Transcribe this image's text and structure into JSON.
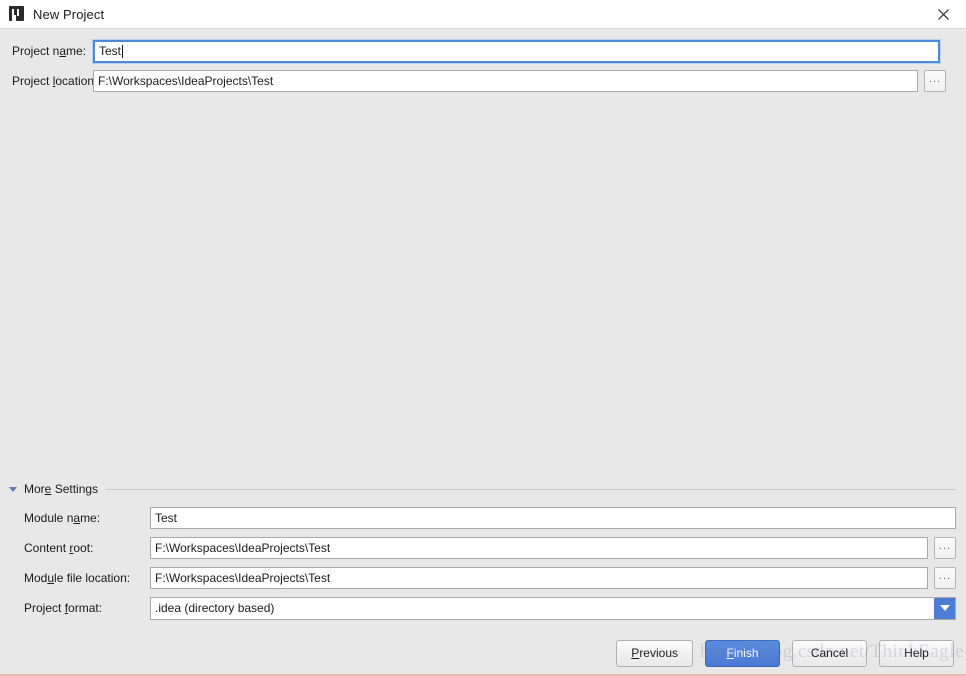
{
  "window": {
    "title": "New Project",
    "icon": "intellij-idea-logo-icon",
    "close_label": "✕"
  },
  "project_fields": [
    {
      "label_pre": "Project n",
      "label_mnemonic": "a",
      "label_post": "me:",
      "value": "Test",
      "focused": true,
      "has_browse": false,
      "name": "project-name"
    },
    {
      "label_pre": "Project ",
      "label_mnemonic": "l",
      "label_post": "ocation:",
      "value": "F:\\Workspaces\\IdeaProjects\\Test",
      "focused": false,
      "has_browse": true,
      "name": "project-location"
    }
  ],
  "more_settings": {
    "title_pre": "Mor",
    "title_mnemonic": "e",
    "title_post": " Settings",
    "expanded": true,
    "fields": [
      {
        "label_pre": "Module n",
        "label_mnemonic": "a",
        "label_post": "me:",
        "value": "Test",
        "type": "text",
        "has_browse": false,
        "name": "module-name"
      },
      {
        "label_pre": "Content ",
        "label_mnemonic": "r",
        "label_post": "oot:",
        "value": "F:\\Workspaces\\IdeaProjects\\Test",
        "type": "text",
        "has_browse": true,
        "name": "content-root"
      },
      {
        "label_pre": "Mod",
        "label_mnemonic": "u",
        "label_post": "le file location:",
        "value": "F:\\Workspaces\\IdeaProjects\\Test",
        "type": "text",
        "has_browse": true,
        "name": "module-file-location"
      },
      {
        "label_pre": "Project ",
        "label_mnemonic": "f",
        "label_post": "ormat:",
        "value": ".idea (directory based)",
        "type": "combo",
        "has_browse": false,
        "name": "project-format"
      }
    ]
  },
  "buttons": [
    {
      "pre": "",
      "mnemonic": "P",
      "post": "revious",
      "primary": false,
      "name": "previous-button"
    },
    {
      "pre": "",
      "mnemonic": "F",
      "post": "inish",
      "primary": true,
      "name": "finish-button"
    },
    {
      "pre": "Cancel",
      "mnemonic": "",
      "post": "",
      "primary": false,
      "name": "cancel-button"
    },
    {
      "pre": "Help",
      "mnemonic": "",
      "post": "",
      "primary": false,
      "name": "help-button"
    }
  ],
  "browse_button_label": "...",
  "watermark": "https://blog.csdn.net/ThinkEagle",
  "colors": {
    "dialog_bg": "#e8e8e8",
    "titlebar_bg": "#ffffff",
    "accent_blue": "#4a7ad4",
    "focus_border": "#4b8ad6",
    "field_bg": "#ffffff",
    "bottom_rule": "#e8b8ad"
  }
}
